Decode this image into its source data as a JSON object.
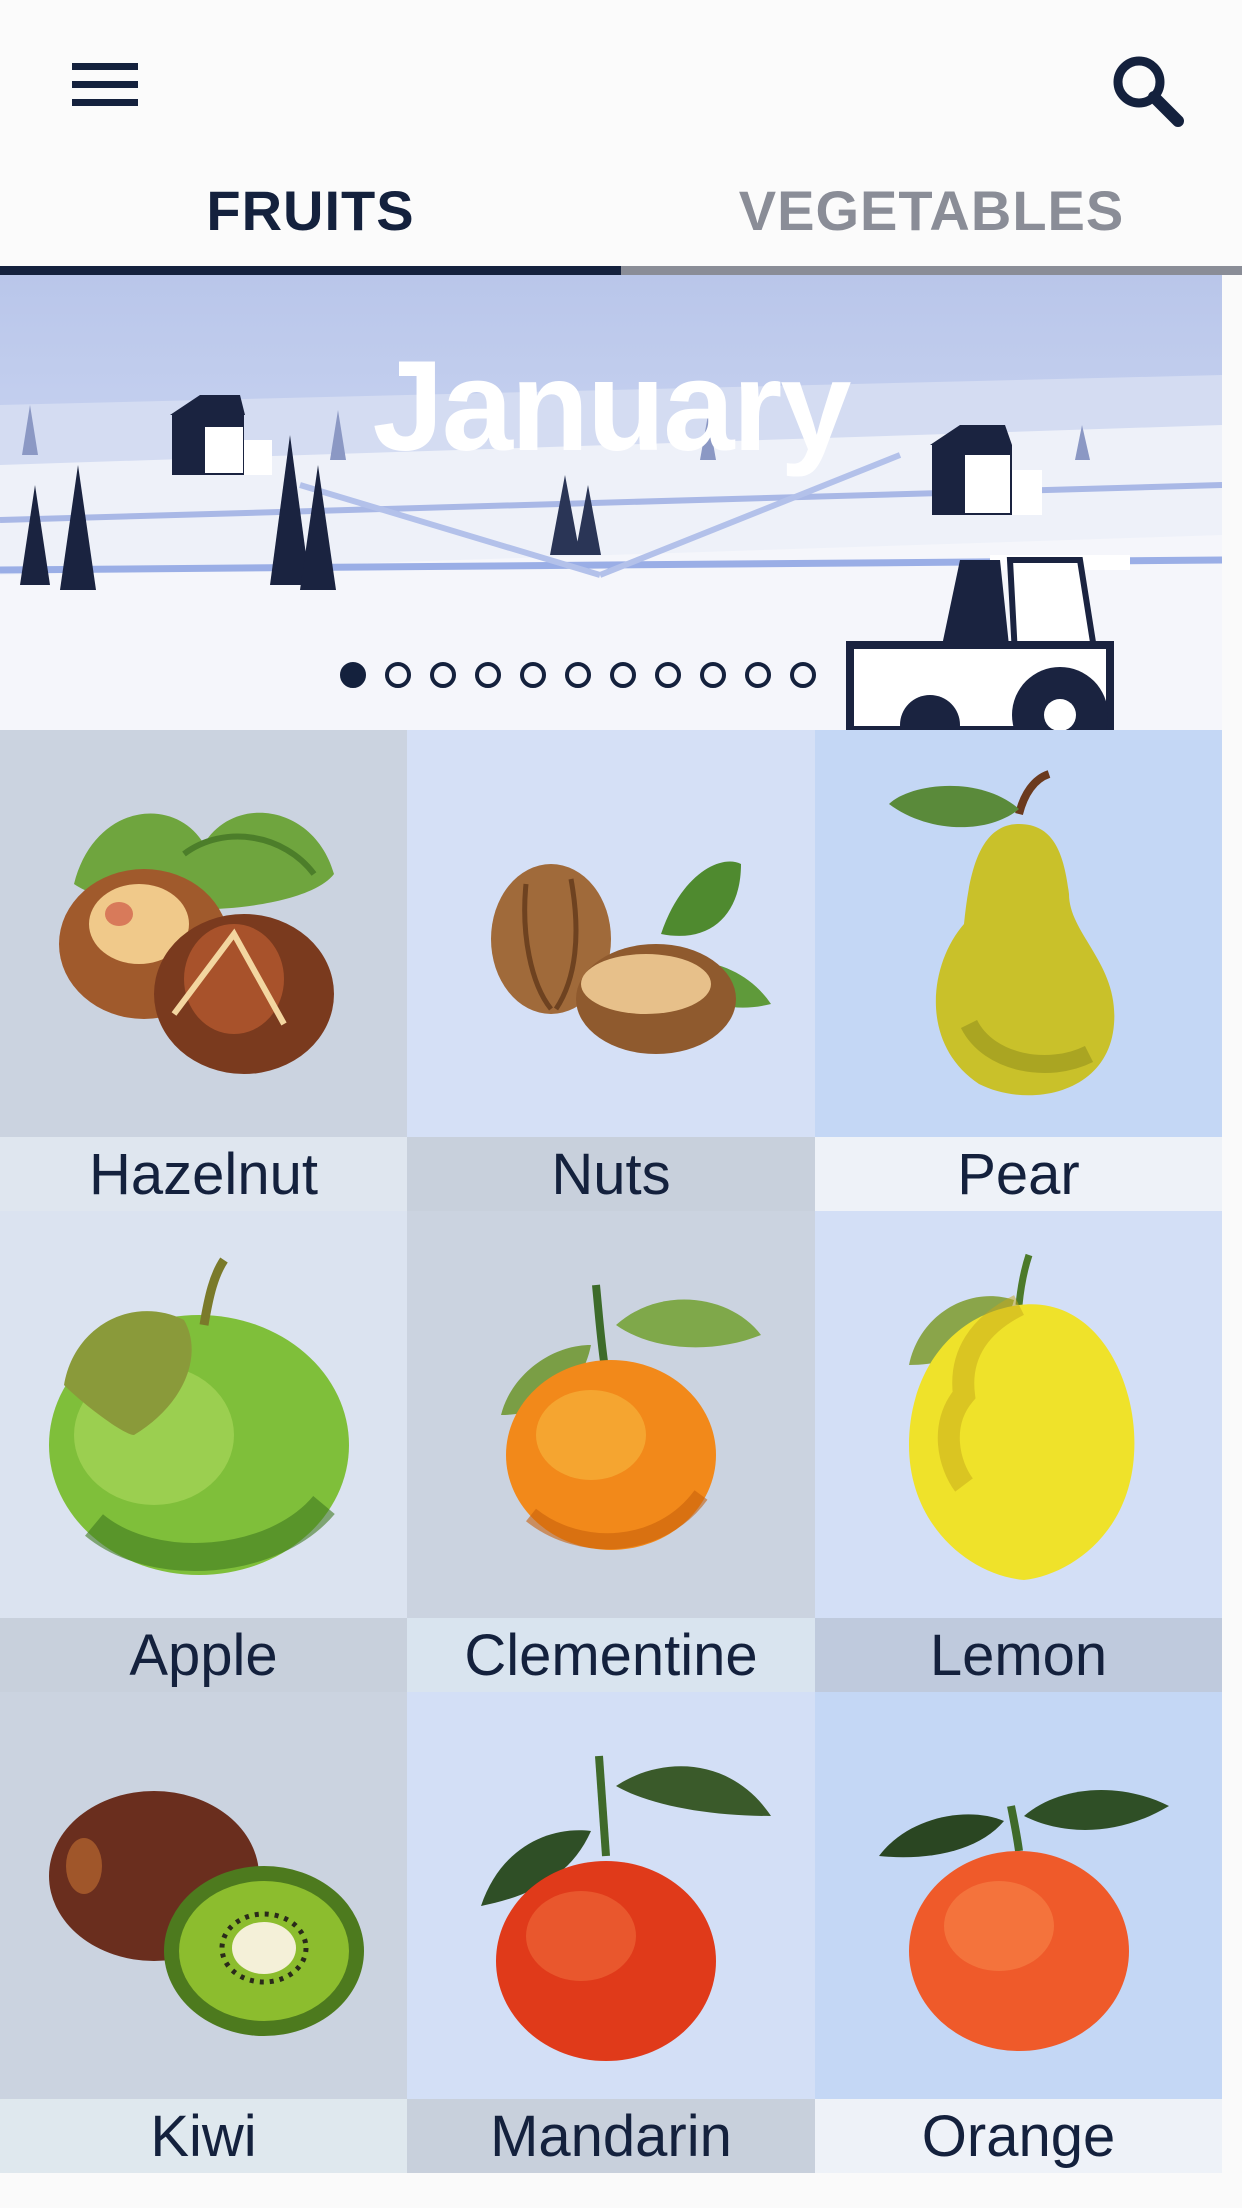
{
  "tabs": [
    {
      "label": "FRUITS",
      "active": true
    },
    {
      "label": "VEGETABLES",
      "active": false
    }
  ],
  "banner": {
    "title": "January",
    "dots_total": 11,
    "active_dot": 0
  },
  "items": [
    {
      "name": "Hazelnut",
      "icon": "hazelnut-icon",
      "bg": "#cbd3e0",
      "label_bg": "#dfe6ef"
    },
    {
      "name": "Nuts",
      "icon": "nuts-icon",
      "bg": "#d5e0f6",
      "label_bg": "#c8d0dc"
    },
    {
      "name": "Pear",
      "icon": "pear-icon",
      "bg": "#c4d7f5",
      "label_bg": "#eef2f8"
    },
    {
      "name": "Apple",
      "icon": "apple-icon",
      "bg": "#dbe3f0",
      "label_bg": "#c8d0dc"
    },
    {
      "name": "Clementine",
      "icon": "clementine-icon",
      "bg": "#cbd3e0",
      "label_bg": "#d9e4ef"
    },
    {
      "name": "Lemon",
      "icon": "lemon-icon",
      "bg": "#d3dff6",
      "label_bg": "#bfcadd"
    },
    {
      "name": "Kiwi",
      "icon": "kiwi-icon",
      "bg": "#cbd3e0",
      "label_bg": "#dfe8ee"
    },
    {
      "name": "Mandarin",
      "icon": "mandarin-icon",
      "bg": "#d3dff6",
      "label_bg": "#c8d0dc"
    },
    {
      "name": "Orange",
      "icon": "orange-icon",
      "bg": "#c4d7f5",
      "label_bg": "#eef2f8"
    }
  ]
}
